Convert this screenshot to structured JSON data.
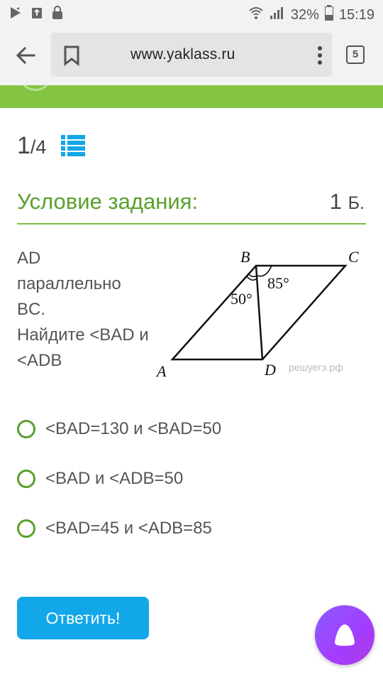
{
  "status_bar": {
    "battery": "32%",
    "time": "15:19"
  },
  "browser": {
    "url": "www.yaklass.ru",
    "tab_count": "5"
  },
  "progress": {
    "current": "1",
    "total": "/4"
  },
  "task": {
    "section_title": "Условие задания:",
    "points_value": "1",
    "points_unit": "Б.",
    "text_lines": [
      "AD",
      "параллельно",
      "BC.",
      "Найдите <BAD и",
      "<ADB"
    ],
    "figure": {
      "label_a": "A",
      "label_b": "B",
      "label_c": "C",
      "label_d": "D",
      "angle_50": "50°",
      "angle_85": "85°",
      "watermark": "решуегэ.рф"
    }
  },
  "options": [
    {
      "label": "<BAD=130 и <BAD=50"
    },
    {
      "label": "<BAD и <ADB=50"
    },
    {
      "label": "<BAD=45 и <ADB=85"
    }
  ],
  "answer_button": {
    "label": "Ответить!"
  },
  "colors": {
    "accent_green": "#5aa02c",
    "band_green": "#84c443",
    "button_blue": "#12a7e8"
  },
  "icons": {
    "back": "arrow-left-icon",
    "bookmark": "bookmark-icon",
    "menu": "kebab-menu-icon",
    "list": "list-icon",
    "assistant": "assistant-icon"
  }
}
